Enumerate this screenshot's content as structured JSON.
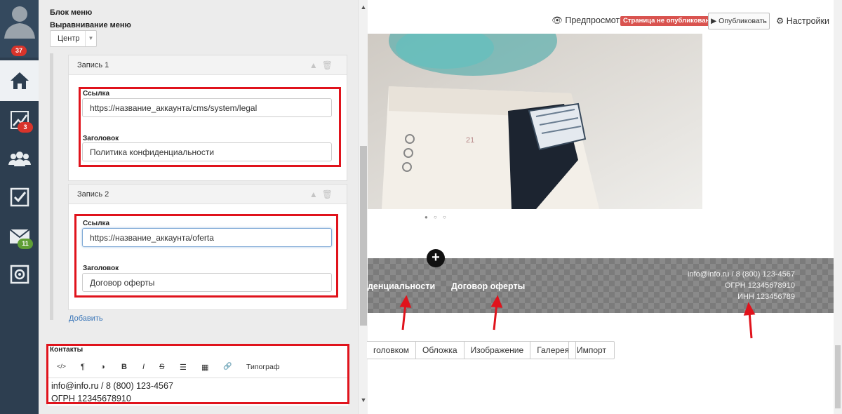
{
  "sidebar": {
    "badges": {
      "notifications": "37",
      "stats": "3",
      "mail": "11"
    }
  },
  "panel": {
    "block_title": "Блок меню",
    "align_label": "Выравнивание меню",
    "align_value": "Центр",
    "entries": [
      {
        "title": "Запись 1",
        "link_label": "Ссылка",
        "link_value": "https://название_аккаунта/cms/system/legal",
        "heading_label": "Заголовок",
        "heading_value": "Политика конфиденциальности"
      },
      {
        "title": "Запись 2",
        "link_label": "Ссылка",
        "link_value": "https://название_аккаунта/oferta",
        "heading_label": "Заголовок",
        "heading_value": "Договор оферты"
      }
    ],
    "add_label": "Добавить",
    "contacts_label": "Контакты",
    "toolbar": {
      "code": "</>",
      "paragraph": "¶",
      "contrast": "◑",
      "bold": "B",
      "italic": "I",
      "strike": "S",
      "list": "☰",
      "table": "▦",
      "link": "🔗",
      "typograph": "Типограф"
    },
    "contacts_lines": [
      "info@info.ru / 8 (800) 123-4567",
      "ОГРН 12345678910"
    ]
  },
  "topbar": {
    "preview": "Предпросмотр",
    "status": "Страница не опубликована",
    "publish": "Опубликовать",
    "settings": "Настройки"
  },
  "footer": {
    "menu": [
      "денциальности",
      "Договор оферты"
    ],
    "contacts": [
      "info@info.ru / 8 (800) 123-4567",
      "ОГРН 12345678910",
      "ИНН 123456789"
    ]
  },
  "tabs": [
    "головком",
    "Обложка",
    "Изображение",
    "Галерея"
  ],
  "import": "Импорт",
  "colors": {
    "sidebar": "#2d3e50",
    "highlight": "#e0131c",
    "status_tag": "#d9534f",
    "link": "#3a76b8"
  }
}
